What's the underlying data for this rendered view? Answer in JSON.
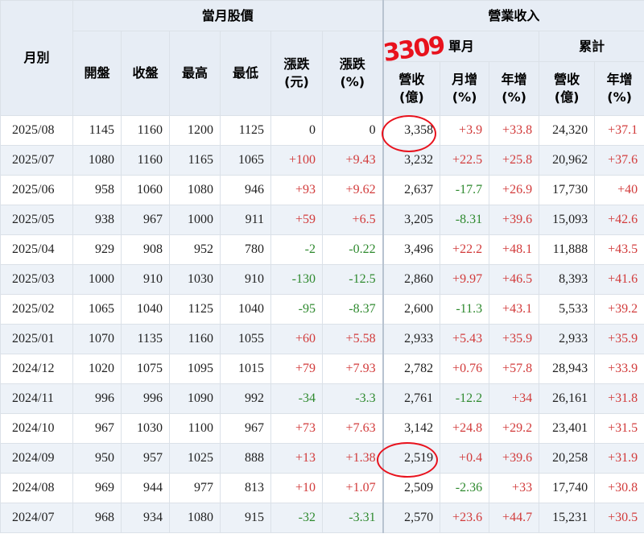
{
  "headers": {
    "month": "月別",
    "stock_group": "當月股價",
    "revenue_group": "營業收入",
    "single_month": "單月",
    "cumulative": "累計",
    "open": "開盤",
    "close": "收盤",
    "high": "最高",
    "low": "最低",
    "change_amt": "漲跌\n(元)",
    "change_pct": "漲跌\n(%)",
    "rev": "營收\n(億)",
    "mom": "月增\n(%)",
    "yoy": "年增\n(%)",
    "cum_rev": "營收\n(億)",
    "cum_yoy": "年增\n(%)"
  },
  "rows": [
    {
      "month": "2025/08",
      "open": "1145",
      "close": "1160",
      "high": "1200",
      "low": "1125",
      "chg": "0",
      "chg_pct": "0",
      "rev": "3,358",
      "mom": "+3.9",
      "yoy": "+33.8",
      "cum_rev": "24,320",
      "cum_yoy": "+37.1"
    },
    {
      "month": "2025/07",
      "open": "1080",
      "close": "1160",
      "high": "1165",
      "low": "1065",
      "chg": "+100",
      "chg_pct": "+9.43",
      "rev": "3,232",
      "mom": "+22.5",
      "yoy": "+25.8",
      "cum_rev": "20,962",
      "cum_yoy": "+37.6"
    },
    {
      "month": "2025/06",
      "open": "958",
      "close": "1060",
      "high": "1080",
      "low": "946",
      "chg": "+93",
      "chg_pct": "+9.62",
      "rev": "2,637",
      "mom": "-17.7",
      "yoy": "+26.9",
      "cum_rev": "17,730",
      "cum_yoy": "+40"
    },
    {
      "month": "2025/05",
      "open": "938",
      "close": "967",
      "high": "1000",
      "low": "911",
      "chg": "+59",
      "chg_pct": "+6.5",
      "rev": "3,205",
      "mom": "-8.31",
      "yoy": "+39.6",
      "cum_rev": "15,093",
      "cum_yoy": "+42.6"
    },
    {
      "month": "2025/04",
      "open": "929",
      "close": "908",
      "high": "952",
      "low": "780",
      "chg": "-2",
      "chg_pct": "-0.22",
      "rev": "3,496",
      "mom": "+22.2",
      "yoy": "+48.1",
      "cum_rev": "11,888",
      "cum_yoy": "+43.5"
    },
    {
      "month": "2025/03",
      "open": "1000",
      "close": "910",
      "high": "1030",
      "low": "910",
      "chg": "-130",
      "chg_pct": "-12.5",
      "rev": "2,860",
      "mom": "+9.97",
      "yoy": "+46.5",
      "cum_rev": "8,393",
      "cum_yoy": "+41.6"
    },
    {
      "month": "2025/02",
      "open": "1065",
      "close": "1040",
      "high": "1125",
      "low": "1040",
      "chg": "-95",
      "chg_pct": "-8.37",
      "rev": "2,600",
      "mom": "-11.3",
      "yoy": "+43.1",
      "cum_rev": "5,533",
      "cum_yoy": "+39.2"
    },
    {
      "month": "2025/01",
      "open": "1070",
      "close": "1135",
      "high": "1160",
      "low": "1055",
      "chg": "+60",
      "chg_pct": "+5.58",
      "rev": "2,933",
      "mom": "+5.43",
      "yoy": "+35.9",
      "cum_rev": "2,933",
      "cum_yoy": "+35.9"
    },
    {
      "month": "2024/12",
      "open": "1020",
      "close": "1075",
      "high": "1095",
      "low": "1015",
      "chg": "+79",
      "chg_pct": "+7.93",
      "rev": "2,782",
      "mom": "+0.76",
      "yoy": "+57.8",
      "cum_rev": "28,943",
      "cum_yoy": "+33.9"
    },
    {
      "month": "2024/11",
      "open": "996",
      "close": "996",
      "high": "1090",
      "low": "992",
      "chg": "-34",
      "chg_pct": "-3.3",
      "rev": "2,761",
      "mom": "-12.2",
      "yoy": "+34",
      "cum_rev": "26,161",
      "cum_yoy": "+31.8"
    },
    {
      "month": "2024/10",
      "open": "967",
      "close": "1030",
      "high": "1100",
      "low": "967",
      "chg": "+73",
      "chg_pct": "+7.63",
      "rev": "3,142",
      "mom": "+24.8",
      "yoy": "+29.2",
      "cum_rev": "23,401",
      "cum_yoy": "+31.5"
    },
    {
      "month": "2024/09",
      "open": "950",
      "close": "957",
      "high": "1025",
      "low": "888",
      "chg": "+13",
      "chg_pct": "+1.38",
      "rev": "2,519",
      "mom": "+0.4",
      "yoy": "+39.6",
      "cum_rev": "20,258",
      "cum_yoy": "+31.9"
    },
    {
      "month": "2024/08",
      "open": "969",
      "close": "944",
      "high": "977",
      "low": "813",
      "chg": "+10",
      "chg_pct": "+1.07",
      "rev": "2,509",
      "mom": "-2.36",
      "yoy": "+33",
      "cum_rev": "17,740",
      "cum_yoy": "+30.8"
    },
    {
      "month": "2024/07",
      "open": "968",
      "close": "934",
      "high": "1080",
      "low": "915",
      "chg": "-32",
      "chg_pct": "-3.31",
      "rev": "2,570",
      "mom": "+23.6",
      "yoy": "+44.7",
      "cum_rev": "15,231",
      "cum_yoy": "+30.5"
    }
  ],
  "annotations": {
    "handwritten_number": "3309",
    "color": "#e8121d"
  },
  "colors": {
    "positive": "#d23b3b",
    "negative": "#2f8a2f",
    "header_bg": "#e7edf5",
    "stripe_bg": "#edf2f8"
  }
}
